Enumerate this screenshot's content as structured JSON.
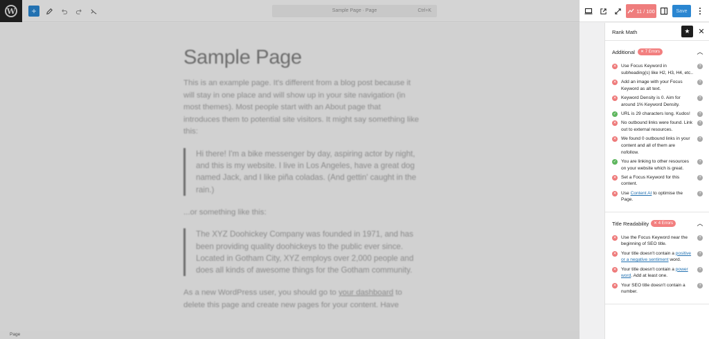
{
  "editor": {
    "doc_title": "Sample Page · Page",
    "shortcut": "Ctrl+K",
    "content": {
      "title": "Sample Page",
      "intro": "This is an example page. It's different from a blog post because it will stay in one place and will show up in your site navigation (in most themes). Most people start with an About page that introduces them to potential site visitors. It might say something like this:",
      "quote1": "Hi there! I'm a bike messenger by day, aspiring actor by night, and this is my website. I live in Los Angeles, have a great dog named Jack, and I like piña coladas. (And gettin' caught in the rain.)",
      "between": "...or something like this:",
      "quote2": "The XYZ Doohickey Company was founded in 1971, and has been providing quality doohickeys to the public ever since. Located in Gotham City, XYZ employs over 2,000 people and does all kinds of awesome things for the Gotham community.",
      "outro_a": "As a new WordPress user, you should go to ",
      "outro_link": "your dashboard",
      "outro_b": " to delete this page and create new pages for your content. Have"
    },
    "status": "Page"
  },
  "header": {
    "score": "11 / 100",
    "save_label": "Save"
  },
  "sidebar": {
    "title": "Rank Math",
    "sections": [
      {
        "label": "Additional",
        "badge": "7 Errors",
        "items": [
          {
            "status": "error",
            "text": "Use Focus Keyword in subheading(s) like H2, H3, H4, etc.."
          },
          {
            "status": "error",
            "text": "Add an image with your Focus Keyword as alt text."
          },
          {
            "status": "error",
            "text": "Keyword Density is 0. Aim for around 1% Keyword Density."
          },
          {
            "status": "ok",
            "text": "URL is 29 characters long. Kudos!"
          },
          {
            "status": "error",
            "text": "No outbound links were found. Link out to external resources."
          },
          {
            "status": "error",
            "text": "We found 0 outbound links in your content and all of them are nofollow."
          },
          {
            "status": "ok",
            "text": "You are linking to other resources on your website which is great."
          },
          {
            "status": "error",
            "text": "Set a Focus Keyword for this content."
          },
          {
            "status": "error",
            "pre": "Use ",
            "link": "Content AI",
            "post": " to optimise the Page."
          }
        ]
      },
      {
        "label": "Title Readability",
        "badge": "4 Errors",
        "items": [
          {
            "status": "error",
            "text": "Use the Focus Keyword near the beginning of SEO title."
          },
          {
            "status": "error",
            "pre": "Your title doesn't contain a ",
            "link": "positive or a negative sentiment",
            "post": " word."
          },
          {
            "status": "error",
            "pre": "Your title doesn't contain a ",
            "link": "power word",
            "post": ". Add at least one."
          },
          {
            "status": "error",
            "text": "Your SEO title doesn't contain a number."
          }
        ]
      }
    ]
  },
  "colors": {
    "error": "#ee7a7a",
    "ok": "#5eb65e",
    "score_bg": "#ef7d7d",
    "save_bg": "#2a86d1",
    "link": "#2271b1"
  },
  "icons": {
    "wp_logo": "wordpress-logo",
    "add": "plus-icon",
    "tools": "pencil-icon",
    "undo": "undo-icon",
    "redo": "redo-icon",
    "details": "list-view-icon",
    "desktop": "desktop-icon",
    "external": "external-link-icon",
    "fullscreen": "fullscreen-icon",
    "sidebar_toggle": "sidebar-icon",
    "more": "more-vertical-icon",
    "pin": "star-icon",
    "close": "close-icon",
    "chevron": "chevron-up-icon",
    "error": "x-circle-icon",
    "ok": "check-circle-icon",
    "help": "help-icon"
  }
}
